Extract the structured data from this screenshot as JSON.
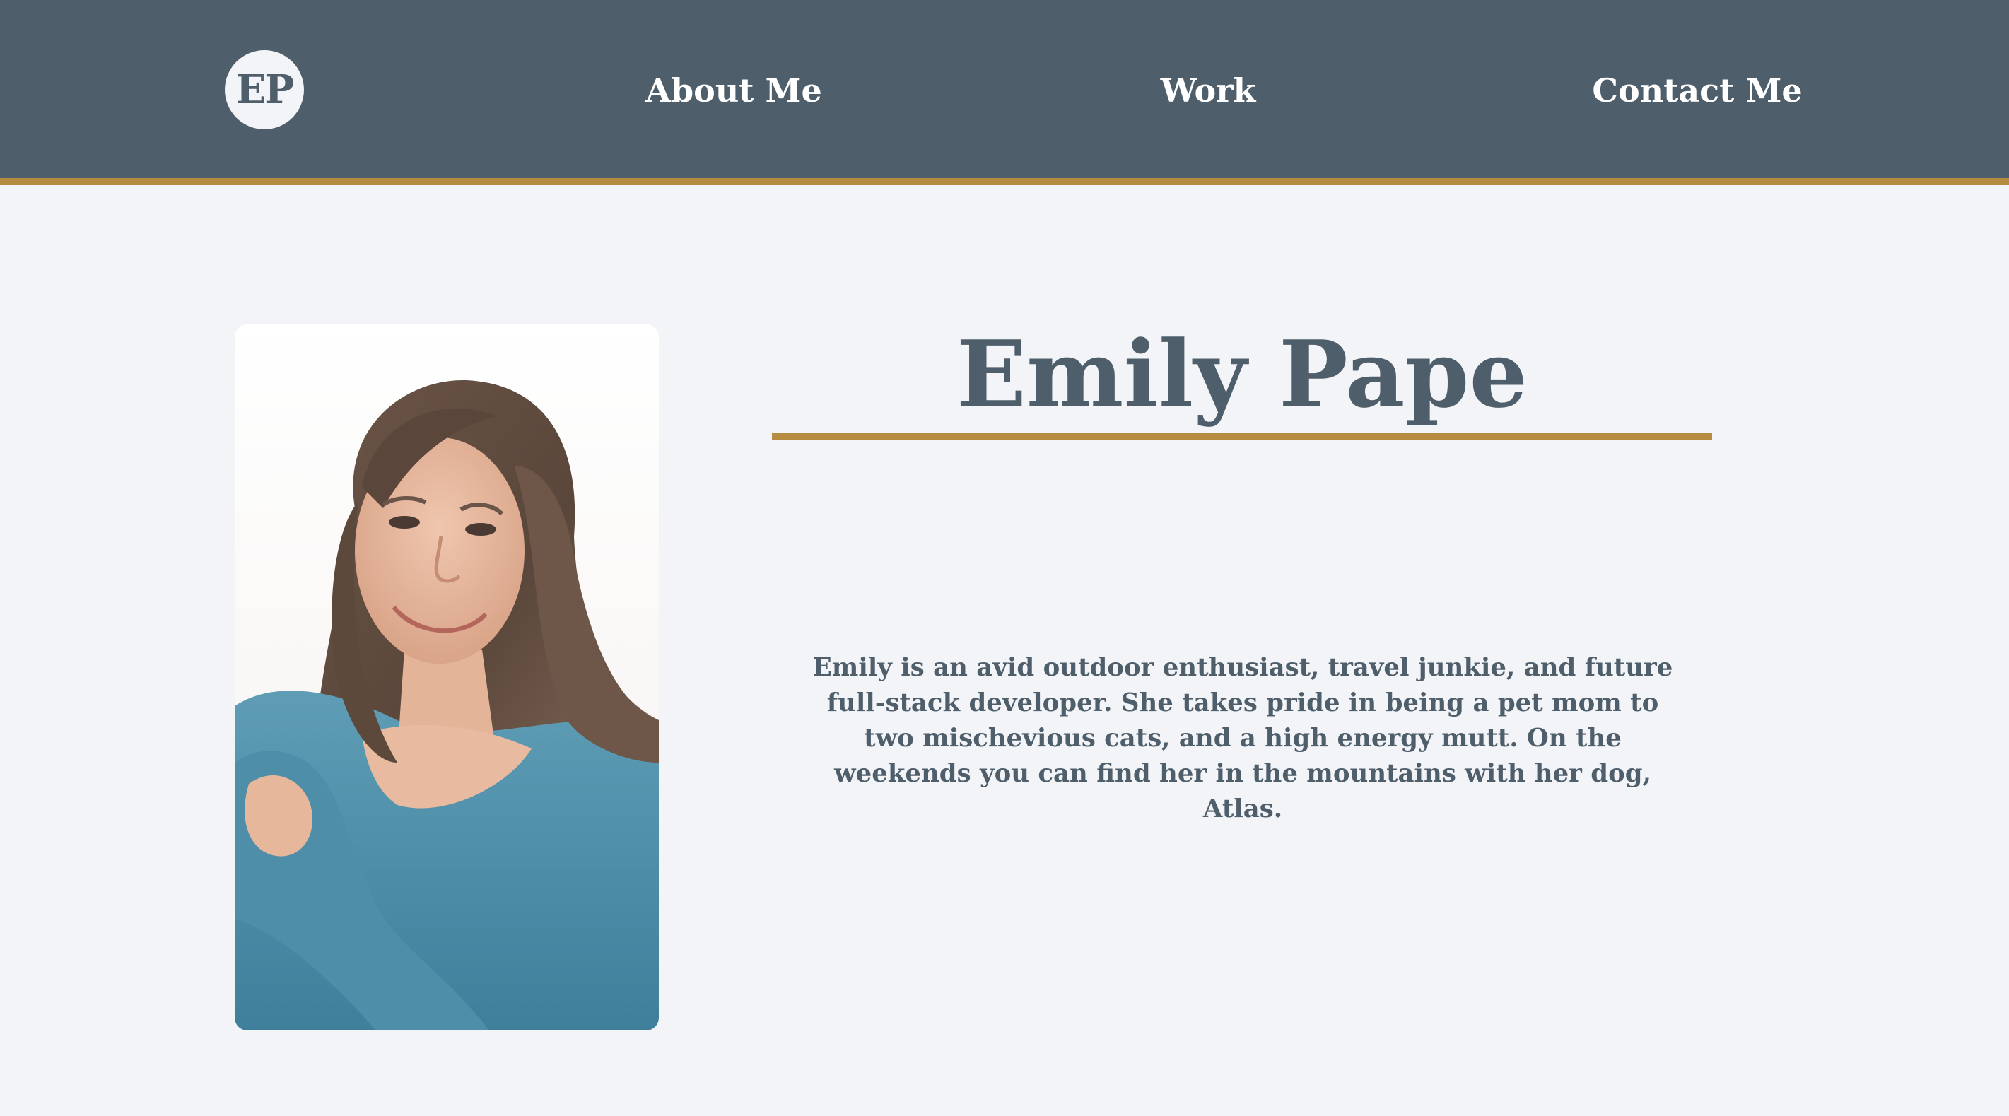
{
  "nav": {
    "logo_text": "EP",
    "links": [
      {
        "label": "About Me"
      },
      {
        "label": "Work"
      },
      {
        "label": "Contact Me"
      }
    ]
  },
  "profile": {
    "name": "Emily Pape",
    "bio": "Emily is an avid outdoor enthusiast, travel junkie, and future full-stack developer. She takes pride in being a pet mom to two mischevious cats, and a high energy mutt. On the weekends you can find her in the mountains with her dog, Atlas.",
    "photo_icon": "portrait-photo"
  },
  "colors": {
    "nav_background": "#4f5e6b",
    "accent": "#b68d40",
    "page_background": "#f3f4f8",
    "text": "#4f5e6b"
  }
}
